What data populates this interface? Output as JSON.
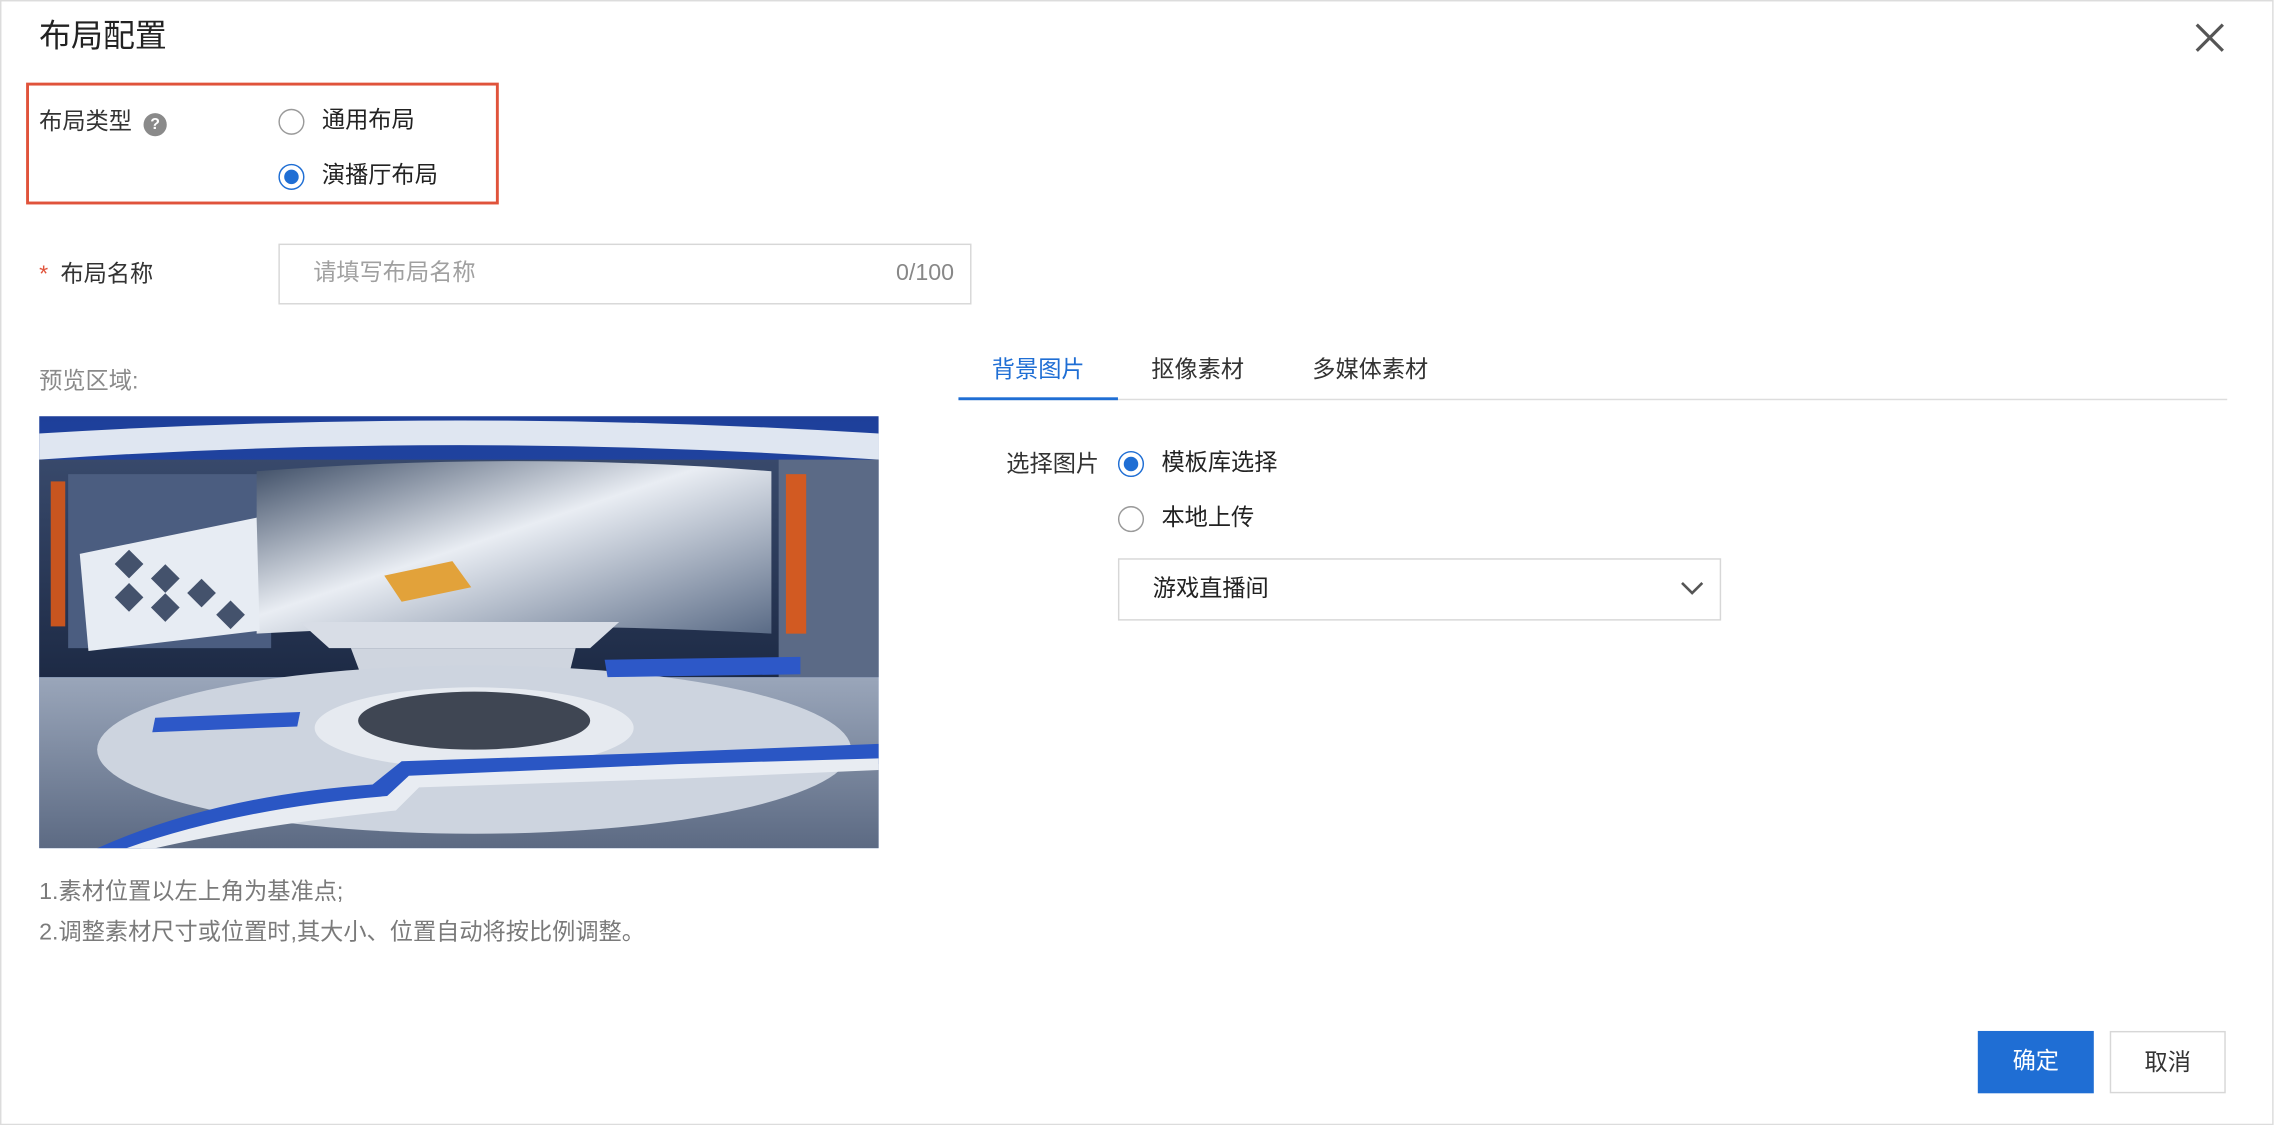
{
  "dialog": {
    "title": "布局配置"
  },
  "layout_type": {
    "label": "布局类型",
    "help_glyph": "?",
    "options": [
      {
        "label": "通用布局",
        "selected": false
      },
      {
        "label": "演播厅布局",
        "selected": true
      }
    ]
  },
  "layout_name": {
    "required_mark": "*",
    "label": "布局名称",
    "placeholder": "请填写布局名称",
    "value": "",
    "counter": "0/100"
  },
  "preview": {
    "label": "预览区域:",
    "notes": [
      "1.素材位置以左上角为基准点;",
      "2.调整素材尺寸或位置时,其大小、位置自动将按比例调整。"
    ]
  },
  "tabs": [
    {
      "label": "背景图片",
      "active": true
    },
    {
      "label": "抠像素材",
      "active": false
    },
    {
      "label": "多媒体素材",
      "active": false
    }
  ],
  "background": {
    "label": "选择图片",
    "source_options": [
      {
        "label": "模板库选择",
        "selected": true
      },
      {
        "label": "本地上传",
        "selected": false
      }
    ],
    "template_select": {
      "value": "游戏直播间"
    }
  },
  "footer": {
    "confirm_label": "确定",
    "cancel_label": "取消"
  },
  "colors": {
    "accent": "#1f6ed4",
    "highlight_border": "#e0533b",
    "required": "#e0533b"
  },
  "icons": [
    "close-icon",
    "help-icon",
    "chevron-down-icon"
  ]
}
